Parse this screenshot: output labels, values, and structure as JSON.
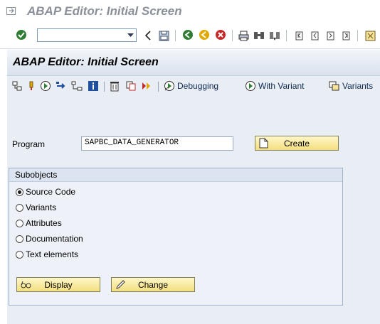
{
  "window": {
    "title": "ABAP Editor: Initial Screen"
  },
  "system_toolbar": {
    "command_value": "",
    "icons": [
      "enter-check-icon",
      "back-arrow-icon",
      "save-icon",
      "back-icon",
      "exit-icon",
      "cancel-icon",
      "print-icon",
      "find-icon",
      "find-next-icon",
      "first-page-icon",
      "previous-page-icon",
      "next-page-icon",
      "last-page-icon",
      "layout-menu-icon"
    ]
  },
  "page": {
    "title": "ABAP Editor: Initial Screen"
  },
  "app_toolbar": {
    "debugging_label": "Debugging",
    "with_variant_label": "With Variant",
    "variants_label": "Variants"
  },
  "program": {
    "label": "Program",
    "value": "SAPBC_DATA_GENERATOR",
    "create_label": "Create"
  },
  "subobjects": {
    "title": "Subobjects",
    "options": [
      "Source Code",
      "Variants",
      "Attributes",
      "Documentation",
      "Text elements"
    ],
    "selected": "Source Code",
    "display_label": "Display",
    "change_label": "Change"
  },
  "colors": {
    "header": "#d9e2ee",
    "button": "#f4df7e",
    "canvas": "#e9eef5"
  }
}
